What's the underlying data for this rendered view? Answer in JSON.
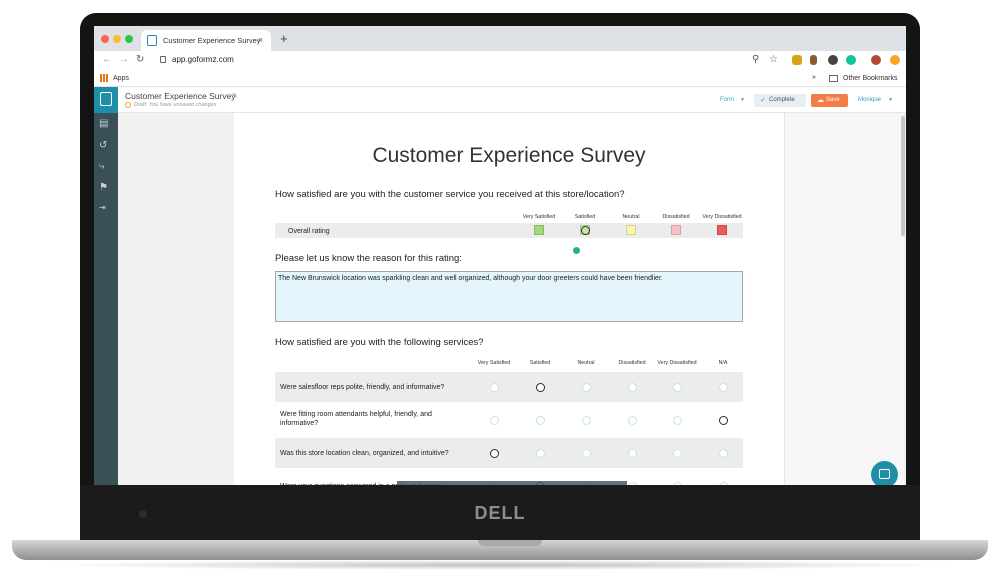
{
  "device": {
    "brand": "DELL"
  },
  "browser": {
    "tab_title": "Customer Experience Survey",
    "tab_close": "×",
    "new_tab": "+",
    "url": "app.goformz.com",
    "bookmarks_apps": "Apps",
    "bookmarks_overflow": "»",
    "bookmarks_other": "Other Bookmarks"
  },
  "app": {
    "form_title": "Customer Experience Survey",
    "draft_status": "Draft: You have unsaved changes",
    "form_menu": "Form",
    "complete_button": "Complete",
    "save_button": "Save",
    "user_menu": "Monique"
  },
  "survey": {
    "title": "Customer Experience Survey",
    "q1": {
      "text": "How satisfied are you with the customer service you received at this store/location?",
      "columns": [
        "Very Satisfied",
        "Satisfied",
        "Neutral",
        "Dissatisfied",
        "Very Dissatisfied"
      ],
      "row_label": "Overall rating",
      "swatch_colors": [
        "#9fdb7b",
        "#c8e8a6",
        "#fbf5b0",
        "#f6c2c7",
        "#ec5a5a"
      ],
      "selected_index": 1
    },
    "q2": {
      "text": "Please let us know the reason for this rating:",
      "answer": "The New Brunswick location was sparkling clean and well organized, although your door greeters could have been friendlier."
    },
    "q3": {
      "text": "How satisfied are you with the following services?",
      "columns": [
        "Very Satisfied",
        "Satisfied",
        "Neutral",
        "Dissatisfied",
        "Very Dissatisfied",
        "N/A"
      ],
      "rows": [
        {
          "label": "Were salesfloor reps polite, friendly, and informative?",
          "selected": 1
        },
        {
          "label": "Were fitting room attendants helpful, friendly, and informative?",
          "selected": 5
        },
        {
          "label": "Was this store location clean, organized, and intuitive?",
          "selected": 0
        },
        {
          "label": "Were your questions answered in a polite and timely",
          "selected": 1
        }
      ]
    }
  },
  "colors": {
    "brand_teal": "#1f8fa8",
    "sidebar": "#3b4f59",
    "save_orange": "#f47c45"
  }
}
